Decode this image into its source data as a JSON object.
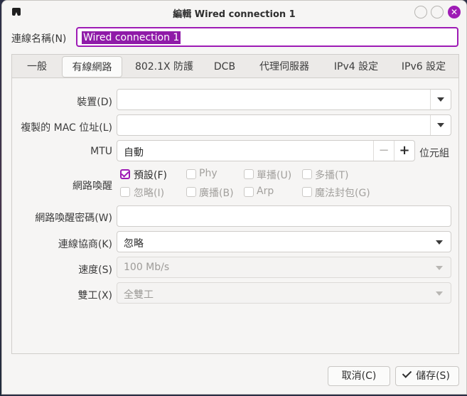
{
  "window": {
    "title": "編輯 Wired connection 1"
  },
  "connection_name": {
    "label": "連線名稱(N)",
    "value": "Wired connection 1"
  },
  "tabs": [
    {
      "label": "一般"
    },
    {
      "label": "有線網路"
    },
    {
      "label": "802.1X 防護"
    },
    {
      "label": "DCB"
    },
    {
      "label": "代理伺服器"
    },
    {
      "label": "IPv4 設定"
    },
    {
      "label": "IPv6 設定"
    }
  ],
  "active_tab": "有線網路",
  "device": {
    "label": "裝置(D)",
    "value": ""
  },
  "cloned_mac": {
    "label": "複製的 MAC 位址(L)",
    "value": ""
  },
  "mtu": {
    "label": "MTU",
    "value": "自動",
    "unit": "位元組",
    "minus": "−",
    "plus": "+"
  },
  "wake_on_lan": {
    "label": "網路喚醒",
    "options": [
      {
        "label": "預設(F)",
        "checked": true
      },
      {
        "label": "Phy",
        "checked": false
      },
      {
        "label": "單播(U)",
        "checked": false
      },
      {
        "label": "多播(T)",
        "checked": false
      },
      {
        "label": "忽略(I)",
        "checked": false
      },
      {
        "label": "廣播(B)",
        "checked": false
      },
      {
        "label": "Arp",
        "checked": false
      },
      {
        "label": "魔法封包(G)",
        "checked": false
      }
    ]
  },
  "wol_password": {
    "label": "網路喚醒密碼(W)",
    "value": ""
  },
  "link_negotiation": {
    "label": "連線協商(K)",
    "value": "忽略"
  },
  "speed": {
    "label": "速度(S)",
    "value": "100 Mb/s"
  },
  "duplex": {
    "label": "雙工(X)",
    "value": "全雙工"
  },
  "buttons": {
    "cancel": "取消(C)",
    "save": "儲存(S)"
  },
  "colors": {
    "accent": "#9e1bb5",
    "window_bg": "#f6f5f4"
  }
}
